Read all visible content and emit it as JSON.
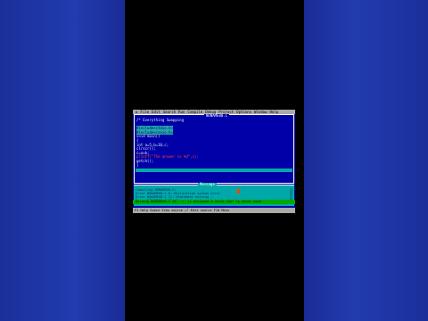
{
  "menubar": {
    "items": [
      "≡",
      "File",
      "Edit",
      "Search",
      "Run",
      "Compile",
      "Debug",
      "Project",
      "Options",
      "Window",
      "Help"
    ]
  },
  "editor": {
    "window_title": "NONAME00.C",
    "lines": [
      "/* Everything Swapping",
      "",
      "#include<stdio.h>",
      "#include<conio.h>",
      "void main()",
      "{",
      "int a=5,b=10,c;",
      "clrscr();",
      "c=a+b;",
      "printf(\"The answer is %d\",c);",
      "getch();",
      "}"
    ],
    "highlighted_lines": [
      2,
      3
    ],
    "string_line_index": 9
  },
  "messages": {
    "window_title": "Message",
    "lines": [
      "Compiling NONAME00.C:",
      "Error NONAME00.C 6: Declaration syntax error",
      "Error NONAME00.C 12: Statement missing ;",
      "Error NONAME00.C 12: Compound statement missing }"
    ],
    "selected_line": "Warning NONAME00.C 13: 'c' is assigned a value that is never used"
  },
  "statusbar": {
    "text": "F1 Help  Space View source  ←┘ Edit source  F10 Menu"
  }
}
